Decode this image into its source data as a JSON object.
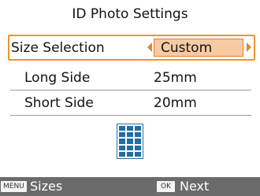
{
  "screen": {
    "title": "ID Photo Settings"
  },
  "settings": {
    "size_selection": {
      "label": "Size Selection",
      "value": "Custom"
    },
    "long_side": {
      "label": "Long Side",
      "value": "25mm"
    },
    "short_side": {
      "label": "Short Side",
      "value": "20mm"
    }
  },
  "preview": {
    "icon": "photo-grid-icon",
    "color": "#1f6ea5"
  },
  "footer": {
    "menu_key": "MENU",
    "menu_label": "Sizes",
    "ok_key": "OK",
    "ok_label": "Next"
  },
  "colors": {
    "accent": "#f0922e",
    "highlight": "#f7caa2",
    "footer_bg": "#6b6b6b"
  }
}
